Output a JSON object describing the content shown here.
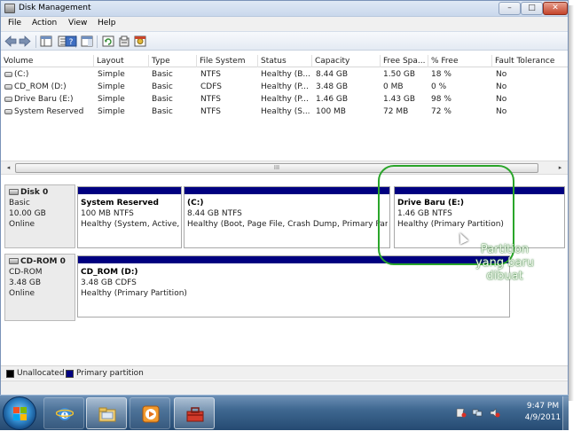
{
  "window": {
    "title": "Disk Management",
    "buttons": {
      "minimize": "–",
      "maximize": "□",
      "close": "✕"
    }
  },
  "menu": [
    "File",
    "Action",
    "View",
    "Help"
  ],
  "table": {
    "columns": [
      "Volume",
      "Layout",
      "Type",
      "File System",
      "Status",
      "Capacity",
      "Free Spa...",
      "% Free",
      "Fault Tolerance"
    ],
    "rows": [
      [
        "(C:)",
        "Simple",
        "Basic",
        "NTFS",
        "Healthy (B...",
        "8.44 GB",
        "1.50 GB",
        "18 %",
        "No"
      ],
      [
        "CD_ROM (D:)",
        "Simple",
        "Basic",
        "CDFS",
        "Healthy (P...",
        "3.48 GB",
        "0 MB",
        "0 %",
        "No"
      ],
      [
        "Drive Baru (E:)",
        "Simple",
        "Basic",
        "NTFS",
        "Healthy (P...",
        "1.46 GB",
        "1.43 GB",
        "98 %",
        "No"
      ],
      [
        "System Reserved",
        "Simple",
        "Basic",
        "NTFS",
        "Healthy (S...",
        "100 MB",
        "72 MB",
        "72 %",
        "No"
      ]
    ]
  },
  "scroll": {
    "left": "◂",
    "right": "▸",
    "grip": "III"
  },
  "disks": [
    {
      "name": "Disk 0",
      "type": "Basic",
      "size": "10.00 GB",
      "state": "Online",
      "partitions": [
        {
          "name": "System Reserved",
          "size_fs": "100 MB NTFS",
          "status": "Healthy (System, Active, P"
        },
        {
          "name": "(C:)",
          "size_fs": "8.44 GB NTFS",
          "status": "Healthy (Boot, Page File, Crash Dump, Primary Partit"
        },
        {
          "name": "Drive Baru  (E:)",
          "size_fs": "1.46 GB NTFS",
          "status": "Healthy (Primary Partition)"
        }
      ]
    },
    {
      "name": "CD-ROM 0",
      "type": "CD-ROM",
      "size": "3.48 GB",
      "state": "Online",
      "partitions": [
        {
          "name": "CD_ROM  (D:)",
          "size_fs": "3.48 GB CDFS",
          "status": "Healthy (Primary Partition)"
        }
      ]
    }
  ],
  "annotation": {
    "text": "Partition yang baru dibuat"
  },
  "legend": [
    {
      "label": "Unallocated",
      "color": "#000000"
    },
    {
      "label": "Primary partition",
      "color": "#000080"
    }
  ],
  "taskbar": {
    "apps": [
      "start-button",
      "internet-explorer",
      "windows-explorer",
      "media-player",
      "toolbox"
    ],
    "clock_time": "9:47 PM",
    "clock_date": "4/9/2011"
  },
  "colors": {
    "primary_partition": "#000080",
    "annotation": "#2aa52a",
    "taskbar": "#3f6891"
  }
}
